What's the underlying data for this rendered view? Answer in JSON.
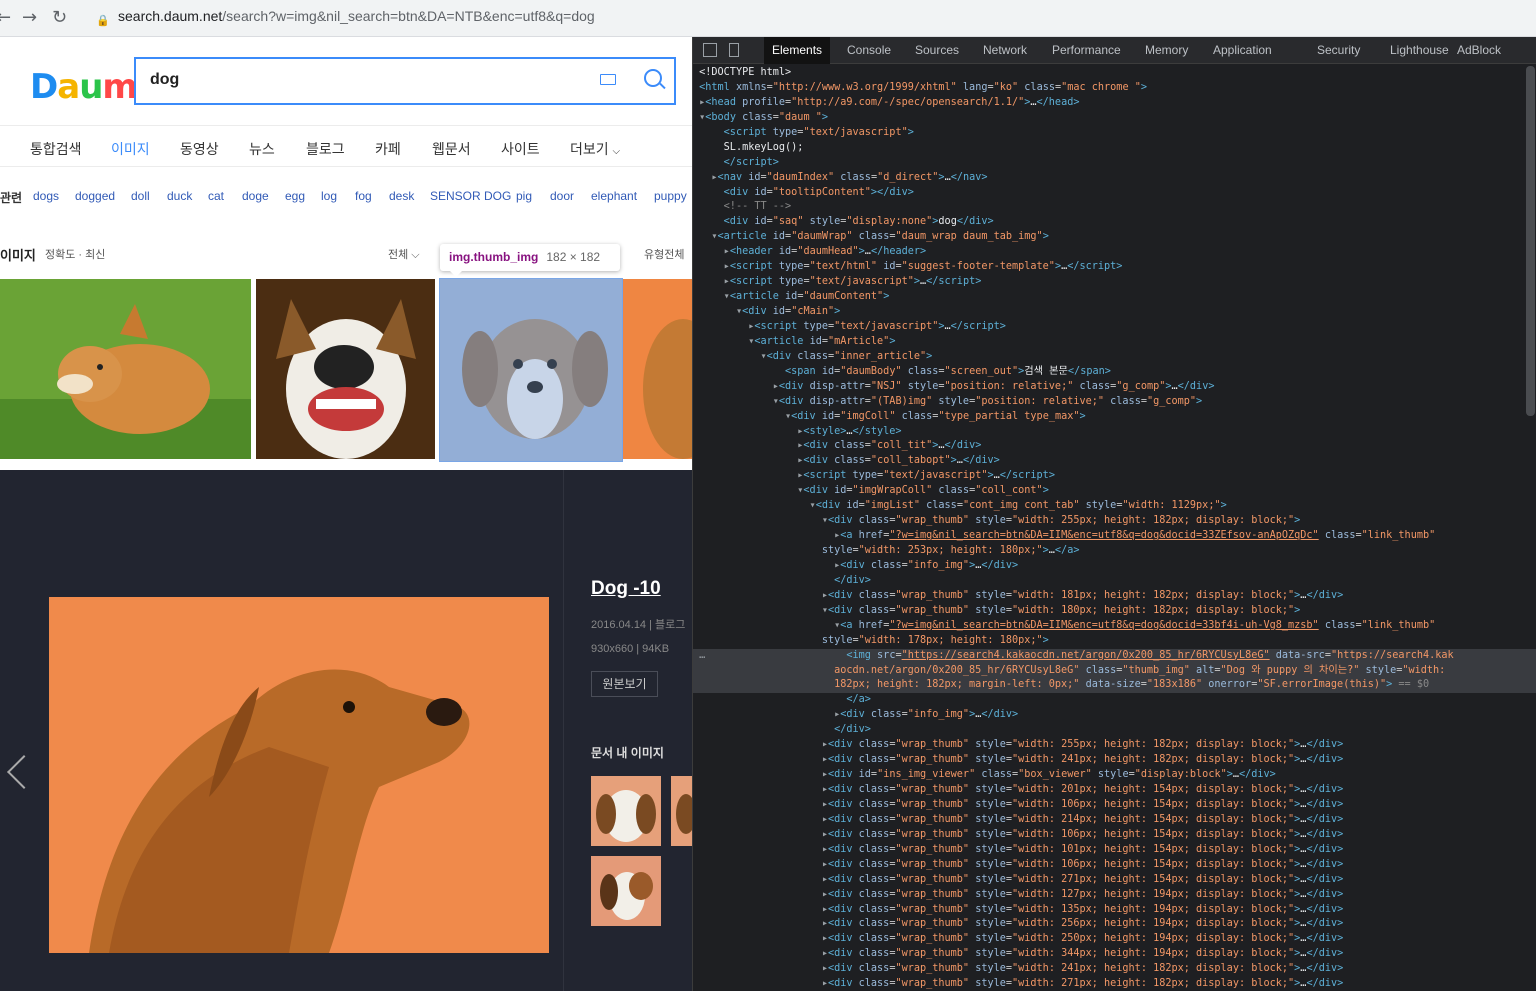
{
  "browser": {
    "url_domain": "search.daum.net",
    "url_path": "/search?w=img&nil_search=btn&DA=NTB&enc=utf8&q=dog"
  },
  "daum": {
    "logo": [
      "D",
      "a",
      "u",
      "m"
    ],
    "query": "dog",
    "tabs": [
      "통합검색",
      "이미지",
      "동영상",
      "뉴스",
      "블로그",
      "카페",
      "웹문서",
      "사이트",
      "더보기"
    ],
    "related_label": "관련",
    "related": [
      "dogs",
      "dogged",
      "doll",
      "duck",
      "cat",
      "doge",
      "egg",
      "log",
      "fog",
      "desk",
      "SENSOR DOG",
      "pig",
      "door",
      "elephant",
      "puppy"
    ],
    "img_header": {
      "title": "이미지",
      "sort": "정확도 · 최신",
      "filter_all": "전체",
      "type_all": "유형전체"
    },
    "tooltip": {
      "selector": "img.thumb_img",
      "size": "182 × 182"
    },
    "viewer": {
      "title": "Dog -10",
      "date": "2016.04.14 | 블로그",
      "size": "930x660 | 94KB",
      "orig_btn": "원본보기",
      "related_imgs": "문서 내 이미지"
    }
  },
  "devtools": {
    "tabs": [
      "Elements",
      "Console",
      "Sources",
      "Network",
      "Performance",
      "Memory",
      "Application",
      "Security",
      "Lighthouse",
      "AdBlock"
    ]
  }
}
